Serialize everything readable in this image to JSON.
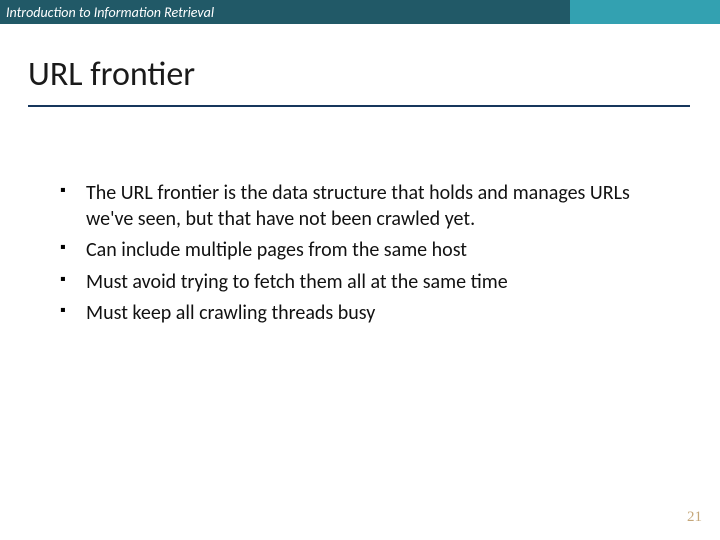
{
  "header": {
    "course": "Introduction to Information Retrieval"
  },
  "title": "URL frontier",
  "bullets": [
    "The URL frontier is the data structure that holds and manages URLs we've seen, but that have not been crawled yet.",
    "Can include multiple pages from the same host",
    "Must avoid trying to fetch them all at the same time",
    "Must keep all crawling threads busy"
  ],
  "page_number": "21"
}
